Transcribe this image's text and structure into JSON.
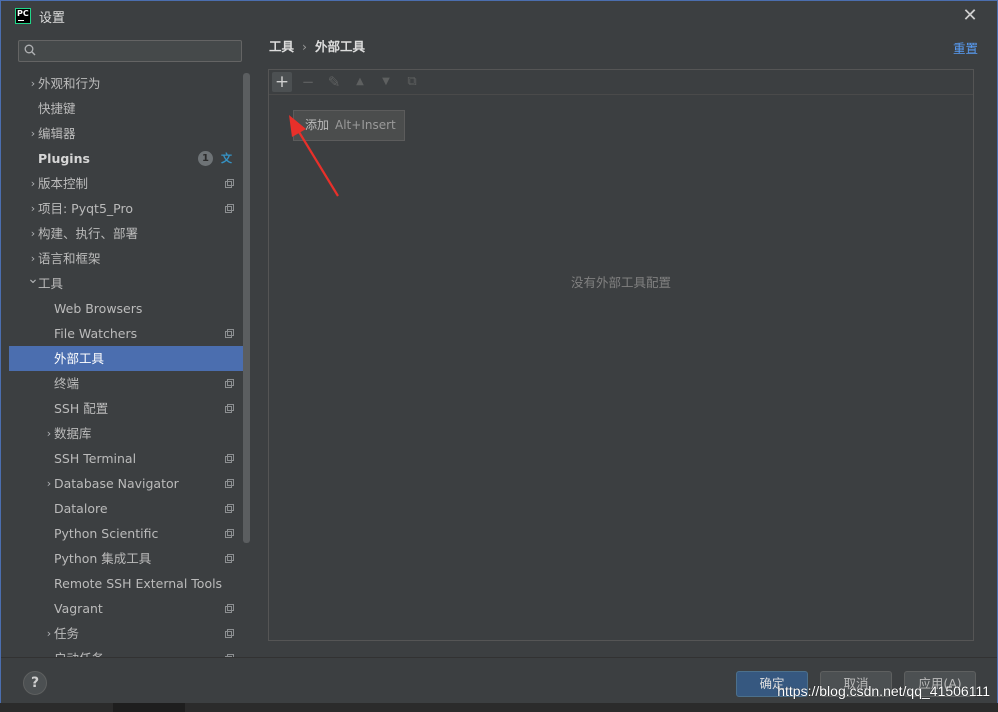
{
  "window": {
    "title": "设置",
    "accent_color": "#4b6eaf"
  },
  "search": {
    "placeholder": "",
    "icon": "search-icon"
  },
  "sidebar": {
    "items": [
      {
        "label": "外观和行为",
        "indent": 0,
        "arrow": "›",
        "bold": false,
        "copy": false
      },
      {
        "label": "快捷键",
        "indent": 0,
        "arrow": "",
        "bold": false,
        "copy": false
      },
      {
        "label": "编辑器",
        "indent": 0,
        "arrow": "›",
        "bold": false,
        "copy": false
      },
      {
        "label": "Plugins",
        "indent": 0,
        "arrow": "",
        "bold": true,
        "copy": false,
        "badge": "1"
      },
      {
        "label": "版本控制",
        "indent": 0,
        "arrow": "›",
        "bold": false,
        "copy": true
      },
      {
        "label": "项目: Pyqt5_Pro",
        "indent": 0,
        "arrow": "›",
        "bold": false,
        "copy": true
      },
      {
        "label": "构建、执行、部署",
        "indent": 0,
        "arrow": "›",
        "bold": false,
        "copy": false
      },
      {
        "label": "语言和框架",
        "indent": 0,
        "arrow": "›",
        "bold": false,
        "copy": false
      },
      {
        "label": "工具",
        "indent": 0,
        "arrow": "⌄",
        "bold": false,
        "copy": false
      },
      {
        "label": "Web Browsers",
        "indent": 1,
        "arrow": "",
        "bold": false,
        "copy": false
      },
      {
        "label": "File Watchers",
        "indent": 1,
        "arrow": "",
        "bold": false,
        "copy": true
      },
      {
        "label": "外部工具",
        "indent": 1,
        "arrow": "",
        "bold": false,
        "copy": false,
        "selected": true
      },
      {
        "label": "终端",
        "indent": 1,
        "arrow": "",
        "bold": false,
        "copy": true
      },
      {
        "label": "SSH 配置",
        "indent": 1,
        "arrow": "",
        "bold": false,
        "copy": true
      },
      {
        "label": "数据库",
        "indent": 1,
        "arrow": "›",
        "bold": false,
        "copy": false
      },
      {
        "label": "SSH Terminal",
        "indent": 1,
        "arrow": "",
        "bold": false,
        "copy": true
      },
      {
        "label": "Database Navigator",
        "indent": 1,
        "arrow": "›",
        "bold": false,
        "copy": true
      },
      {
        "label": "Datalore",
        "indent": 1,
        "arrow": "",
        "bold": false,
        "copy": true
      },
      {
        "label": "Python Scientific",
        "indent": 1,
        "arrow": "",
        "bold": false,
        "copy": true
      },
      {
        "label": "Python 集成工具",
        "indent": 1,
        "arrow": "",
        "bold": false,
        "copy": true
      },
      {
        "label": "Remote SSH External Tools",
        "indent": 1,
        "arrow": "",
        "bold": false,
        "copy": false
      },
      {
        "label": "Vagrant",
        "indent": 1,
        "arrow": "",
        "bold": false,
        "copy": true
      },
      {
        "label": "任务",
        "indent": 1,
        "arrow": "›",
        "bold": false,
        "copy": true
      },
      {
        "label": "启动任务",
        "indent": 1,
        "arrow": "",
        "bold": false,
        "copy": true
      }
    ]
  },
  "breadcrumb": {
    "parent": "工具",
    "separator": "›",
    "current": "外部工具"
  },
  "reset_label": "重置",
  "toolbar": {
    "add": "+",
    "remove": "−",
    "edit": "✎",
    "up": "▲",
    "down": "▼",
    "copy": "⧉"
  },
  "tooltip": {
    "label": "添加",
    "shortcut": "Alt+Insert"
  },
  "empty_text": "没有外部工具配置",
  "help_label": "?",
  "buttons": {
    "ok": "确定",
    "cancel": "取消",
    "apply": "应用(A)"
  },
  "watermark": "https://blog.csdn.net/qq_41506111"
}
